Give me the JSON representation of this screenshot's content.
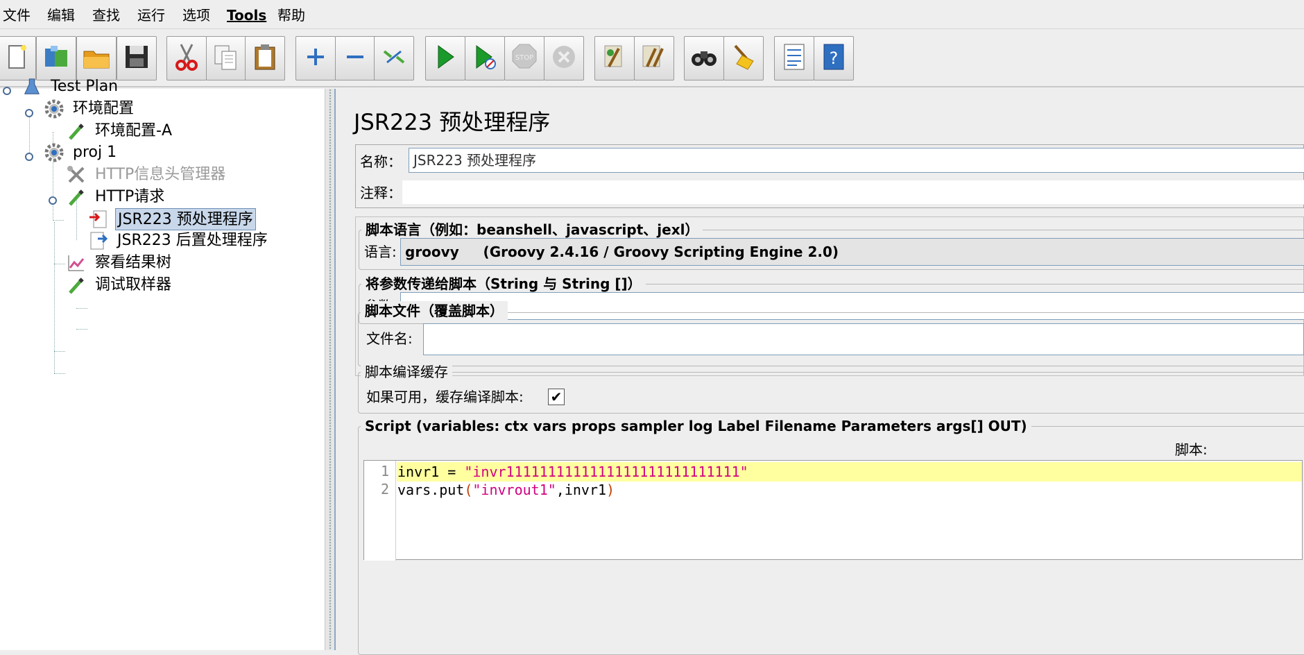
{
  "menu": [
    "文件",
    "编辑",
    "查找",
    "运行",
    "选项",
    "Tools",
    "帮助"
  ],
  "toolbar": [
    "new-icon",
    "templates-icon",
    "open-icon",
    "save-icon",
    "cut-icon",
    "copy-icon",
    "paste-icon",
    "expand-icon",
    "collapse-icon",
    "toggle-icon",
    "start-icon",
    "start-no-pauses-icon",
    "stop-icon",
    "shutdown-icon",
    "clear-icon",
    "clear-all-icon",
    "search-icon",
    "reset-search-icon",
    "function-helper-icon",
    "help-icon"
  ],
  "tree": {
    "test_plan": "Test Plan",
    "env_config": "环境配置",
    "env_config_a": "环境配置-A",
    "proj": "proj 1",
    "http_header": "HTTP信息头管理器",
    "http_request": "HTTP请求",
    "pre_processor": "JSR223 预处理程序",
    "post_processor": "JSR223 后置处理程序",
    "results_tree": "察看结果树",
    "debug_sampler": "调试取样器"
  },
  "panel": {
    "title": "JSR223 预处理程序",
    "name_label": "名称：",
    "name_value": "JSR223 预处理程序",
    "comment_label": "注释：",
    "comment_value": "",
    "lang_group": "脚本语言（例如：beanshell、javascript、jexl）",
    "lang_label": "语言:",
    "lang_value": "groovy     (Groovy 2.4.16 / Groovy Scripting Engine 2.0)",
    "params_group": "将参数传递给脚本（String 与 String []）",
    "params_label": "参数:",
    "params_value": "",
    "file_group": "脚本文件（覆盖脚本）",
    "file_label": "文件名:",
    "file_value": "",
    "cache_group": "脚本编译缓存",
    "cache_label": "如果可用，缓存编译脚本:",
    "cache_checked": true,
    "script_group": "Script (variables: ctx vars props sampler log Label Filename Parameters args[] OUT)",
    "script_label": "脚本:"
  },
  "code": {
    "line1_no": "1",
    "line1_a": "invr1 = ",
    "line1_b": "\"invr1111111111111111111111111111\"",
    "line2_no": "2",
    "line2_a": "vars.put",
    "line2_b": "(",
    "line2_c": "\"invrout1\"",
    "line2_d": ",invr1",
    "line2_e": ")"
  },
  "colors": {
    "highlight_line": "#ffffa0",
    "string": "#d00080",
    "selection": "#c8d7ea"
  }
}
